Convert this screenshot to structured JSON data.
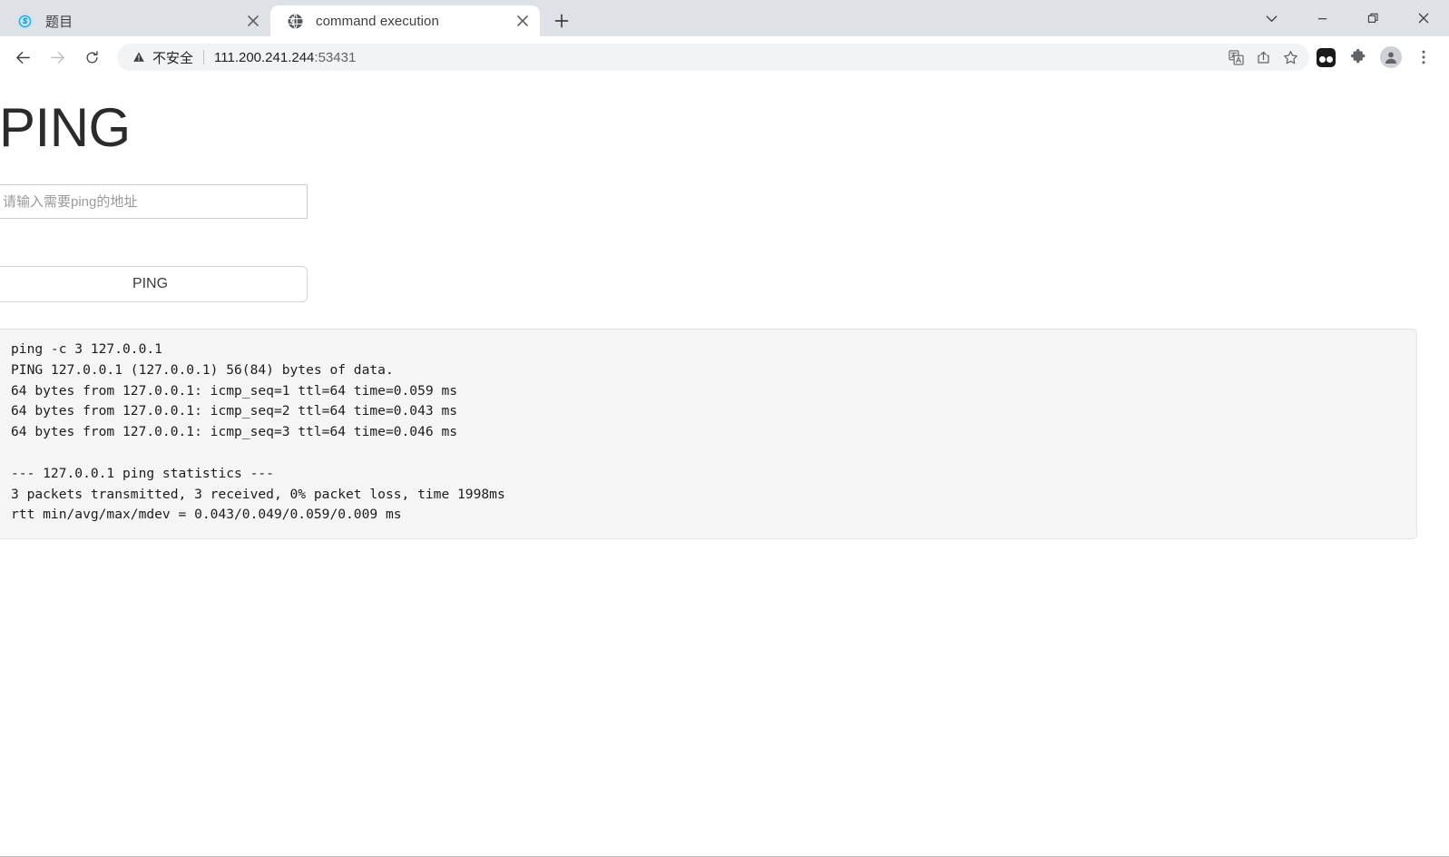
{
  "window": {
    "controls": [
      {
        "name": "tab-search",
        "icon": "chevron-down-icon"
      },
      {
        "name": "minimize",
        "icon": "minimize-icon"
      },
      {
        "name": "restore",
        "icon": "restore-icon"
      },
      {
        "name": "close",
        "icon": "close-icon"
      }
    ]
  },
  "tabs": [
    {
      "title": "题目",
      "favicon": "site-favicon-blue",
      "active": false
    },
    {
      "title": "command execution",
      "favicon": "globe-icon",
      "active": true
    }
  ],
  "newtab": {
    "label": "+",
    "name": "new-tab-button"
  },
  "toolbar": {
    "back": "back-icon",
    "forward": "forward-icon",
    "reload": "reload-icon",
    "security_label": "不安全",
    "url_host": "111.200.241.244",
    "url_port": ":53431",
    "actions": [
      {
        "name": "translate-icon"
      },
      {
        "name": "share-icon"
      },
      {
        "name": "bookmark-star-icon"
      }
    ],
    "right_icons": [
      {
        "name": "extension-black-icon"
      },
      {
        "name": "puzzle-piece-icon"
      },
      {
        "name": "profile-avatar-icon"
      },
      {
        "name": "more-menu-icon"
      }
    ]
  },
  "page": {
    "title": "PING",
    "input": {
      "placeholder": "请输入需要ping的地址",
      "value": ""
    },
    "button_label": "PING",
    "output": "ping -c 3 127.0.0.1\nPING 127.0.0.1 (127.0.0.1) 56(84) bytes of data.\n64 bytes from 127.0.0.1: icmp_seq=1 ttl=64 time=0.059 ms\n64 bytes from 127.0.0.1: icmp_seq=2 ttl=64 time=0.043 ms\n64 bytes from 127.0.0.1: icmp_seq=3 ttl=64 time=0.046 ms\n\n--- 127.0.0.1 ping statistics ---\n3 packets transmitted, 3 received, 0% packet loss, time 1998ms\nrtt min/avg/max/mdev = 0.043/0.049/0.059/0.009 ms"
  },
  "colors": {
    "tabstrip_bg": "#dee1e6",
    "active_tab_bg": "#ffffff",
    "omnibox_bg": "#f1f3f4",
    "output_bg": "#f5f5f5",
    "output_border": "#e3e3e3"
  }
}
